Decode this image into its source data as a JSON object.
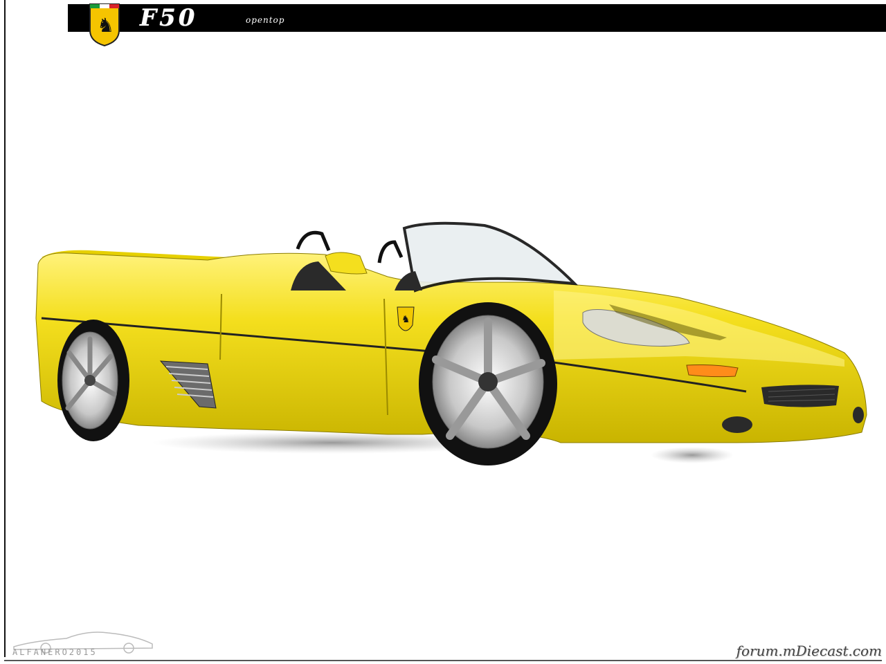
{
  "header": {
    "title": "F50",
    "subtitle": "opentop"
  },
  "watermarks": {
    "left": "ALFANERO2015",
    "right": "forum.mDiecast.com"
  },
  "colors": {
    "banner": "#000000",
    "car_body": "#f2dc1a",
    "background": "#ffffff"
  },
  "icons": {
    "brand": "prancing-horse-shield-icon"
  }
}
